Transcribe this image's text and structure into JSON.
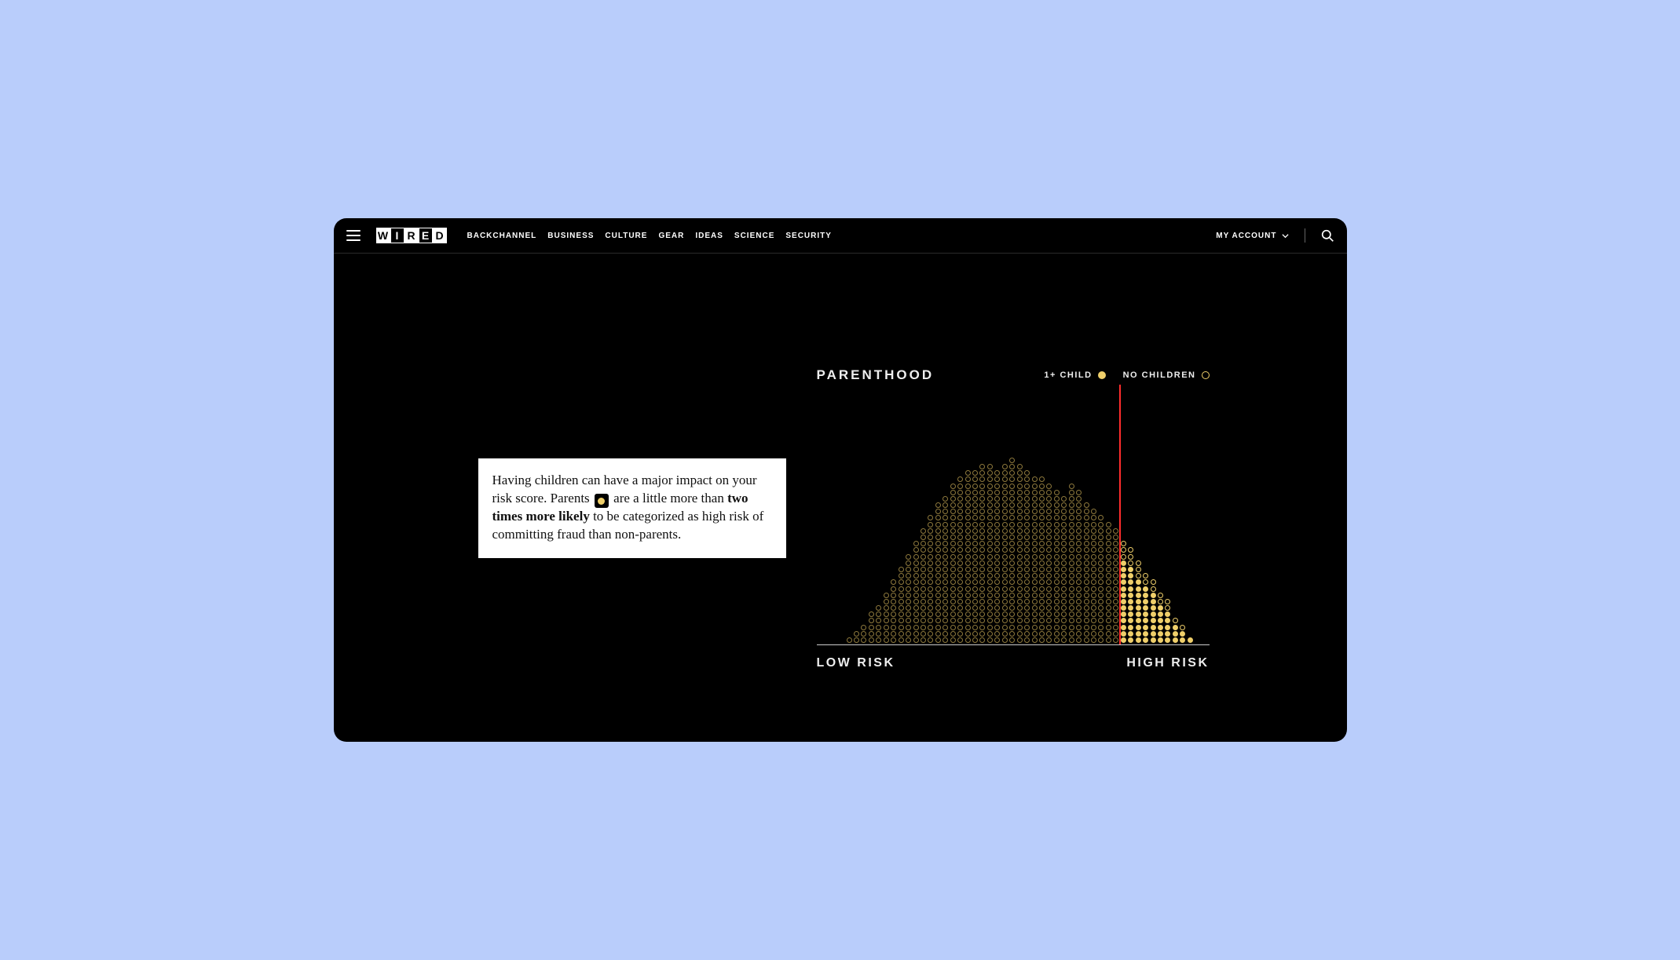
{
  "nav": {
    "items": [
      "BACKCHANNEL",
      "BUSINESS",
      "CULTURE",
      "GEAR",
      "IDEAS",
      "SCIENCE",
      "SECURITY"
    ],
    "account": "MY ACCOUNT"
  },
  "logo_letters": [
    "W",
    "I",
    "R",
    "E",
    "D"
  ],
  "callout": {
    "p1": "Having children can have a major impact on your risk score. Parents ",
    "p2": " are a little more than ",
    "bold": "two times more likely",
    "p3": " to be categorized as high risk of committing fraud than non-parents."
  },
  "chart_data": {
    "type": "bar",
    "title": "PARENTHOOD",
    "xlabel_low": "LOW RISK",
    "xlabel_high": "HIGH RISK",
    "legend": [
      {
        "name": "1+ CHILD",
        "style": "filled"
      },
      {
        "name": "NO CHILDREN",
        "style": "hollow"
      }
    ],
    "threshold_pct": 77,
    "n_bins": 50,
    "series": [
      {
        "name": "1+ CHILD",
        "values": [
          0,
          0,
          1,
          1,
          2,
          3,
          4,
          5,
          6,
          7,
          8,
          9,
          10,
          11,
          12,
          12,
          13,
          14,
          14,
          13,
          15,
          15,
          14,
          16,
          17,
          16,
          15,
          14,
          15,
          14,
          13,
          13,
          14,
          13,
          12,
          11,
          11,
          10,
          10,
          13,
          12,
          10,
          9,
          8,
          6,
          5,
          3,
          2,
          1,
          0
        ]
      },
      {
        "name": "NO CHILDREN",
        "values": [
          0,
          0,
          0,
          1,
          1,
          2,
          2,
          3,
          4,
          5,
          6,
          7,
          8,
          9,
          10,
          11,
          12,
          12,
          13,
          14,
          13,
          13,
          13,
          12,
          12,
          12,
          12,
          12,
          11,
          11,
          11,
          10,
          11,
          11,
          10,
          10,
          9,
          9,
          8,
          3,
          3,
          3,
          2,
          2,
          2,
          2,
          1,
          1,
          0,
          0
        ]
      }
    ],
    "ylim": [
      0,
      35
    ]
  }
}
